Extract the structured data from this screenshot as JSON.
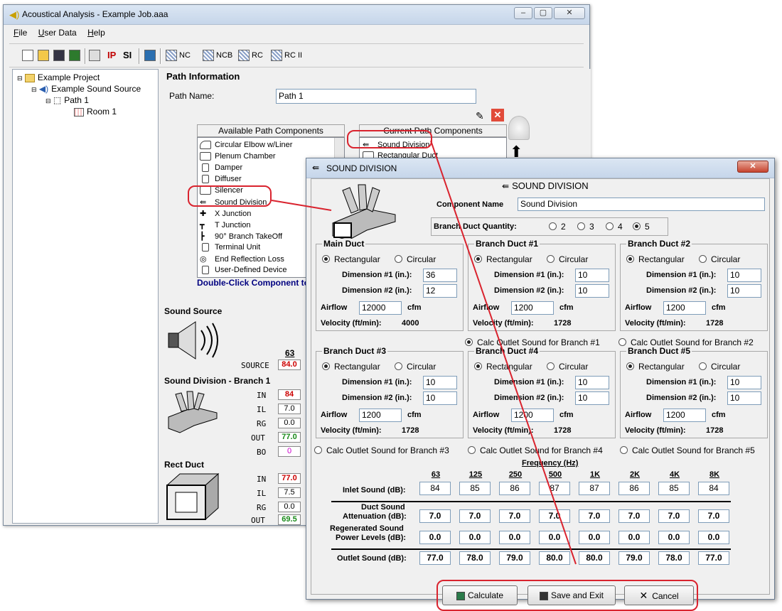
{
  "main_window": {
    "title": "Acoustical Analysis - Example Job.aaa",
    "title_buttons": [
      "–",
      "▢",
      "✕"
    ],
    "menu": [
      "File",
      "User Data",
      "Help"
    ],
    "toolbar": {
      "ip": "IP",
      "si": "SI",
      "nc": "NC",
      "ncb": "NCB",
      "rc": "RC",
      "rc2": "RC II"
    }
  },
  "tree": {
    "items": [
      "Example Project",
      "Example Sound Source",
      "Path 1",
      "Room 1"
    ]
  },
  "path_info": {
    "heading": "Path Information",
    "path_name_label": "Path Name:",
    "path_name_value": "Path 1",
    "available_header": "Available Path Components",
    "current_header": "Current Path Components",
    "available_items": [
      "Circular Elbow w/Liner",
      "Plenum Chamber",
      "Damper",
      "Diffuser",
      "Silencer",
      "Sound Division",
      "X Junction",
      "T Junction",
      "90° Branch TakeOff",
      "Terminal Unit",
      "End Reflection Loss",
      "User-Defined Device"
    ],
    "current_items": [
      "Sound Division",
      "Rectangular Duct"
    ],
    "hint": "Double-Click Component to"
  },
  "summary": {
    "sound_source_label": "Sound Source",
    "freq_63": "63",
    "source_label": "SOURCE",
    "source_value": "84.0",
    "sd_label": "Sound Division - Branch 1",
    "sd_rows": [
      {
        "label": "IN",
        "value": "84"
      },
      {
        "label": "IL",
        "value": "7.0"
      },
      {
        "label": "RG",
        "value": "0.0"
      },
      {
        "label": "OUT",
        "value": "77.0"
      },
      {
        "label": "BO",
        "value": "0"
      }
    ],
    "rect_label": "Rect Duct",
    "rect_rows": [
      {
        "label": "IN",
        "value": "77.0"
      },
      {
        "label": "IL",
        "value": "7.5"
      },
      {
        "label": "RG",
        "value": "0.0"
      },
      {
        "label": "OUT",
        "value": "69.5"
      }
    ]
  },
  "dialog": {
    "title": "SOUND DIVISION",
    "close": "✕",
    "header": "SOUND DIVISION",
    "component_name_label": "Component Name",
    "component_name_value": "Sound Division",
    "branch_qty_label": "Branch Duct Quantity:",
    "branch_qty_options": [
      "2",
      "3",
      "4",
      "5"
    ],
    "branch_qty_selected": "5",
    "rect_label": "Rectangular",
    "circ_label": "Circular",
    "dim1_label": "Dimension #1 (in.):",
    "dim2_label": "Dimension #2 (in.):",
    "airflow_label": "Airflow",
    "cfm": "cfm",
    "velocity_label": "Velocity (ft/min):",
    "ducts": [
      {
        "title": "Main Duct",
        "dim1": "36",
        "dim2": "12",
        "airflow": "12000",
        "velocity": "4000"
      },
      {
        "title": "Branch Duct #1",
        "dim1": "10",
        "dim2": "10",
        "airflow": "1200",
        "velocity": "1728"
      },
      {
        "title": "Branch Duct #2",
        "dim1": "10",
        "dim2": "10",
        "airflow": "1200",
        "velocity": "1728"
      },
      {
        "title": "Branch Duct #3",
        "dim1": "10",
        "dim2": "10",
        "airflow": "1200",
        "velocity": "1728"
      },
      {
        "title": "Branch Duct #4",
        "dim1": "10",
        "dim2": "10",
        "airflow": "1200",
        "velocity": "1728"
      },
      {
        "title": "Branch Duct #5",
        "dim1": "10",
        "dim2": "10",
        "airflow": "1200",
        "velocity": "1728"
      }
    ],
    "calc_outlet": [
      "Calc Outlet Sound for Branch #1",
      "Calc Outlet Sound for Branch #2",
      "Calc Outlet Sound for Branch #3",
      "Calc Outlet Sound for Branch #4",
      "Calc Outlet Sound for Branch #5"
    ],
    "calc_outlet_selected": 0,
    "frequency_label": "Frequency (Hz)",
    "freqs": [
      "63",
      "125",
      "250",
      "500",
      "1K",
      "2K",
      "4K",
      "8K"
    ],
    "inlet_label": "Inlet Sound (dB):",
    "inlet": [
      "84",
      "85",
      "86",
      "87",
      "87",
      "86",
      "85",
      "84"
    ],
    "atten_label1": "Duct Sound",
    "atten_label2": "Attenuation (dB):",
    "atten": [
      "7.0",
      "7.0",
      "7.0",
      "7.0",
      "7.0",
      "7.0",
      "7.0",
      "7.0"
    ],
    "regen_label1": "Regenerated Sound",
    "regen_label2": "Power Levels (dB):",
    "regen": [
      "0.0",
      "0.0",
      "0.0",
      "0.0",
      "0.0",
      "0.0",
      "0.0",
      "0.0"
    ],
    "outlet_label": "Outlet Sound (dB):",
    "outlet": [
      "77.0",
      "78.0",
      "79.0",
      "80.0",
      "80.0",
      "79.0",
      "78.0",
      "77.0"
    ],
    "buttons": {
      "calculate": "Calculate",
      "save": "Save and Exit",
      "cancel": "Cancel"
    }
  }
}
